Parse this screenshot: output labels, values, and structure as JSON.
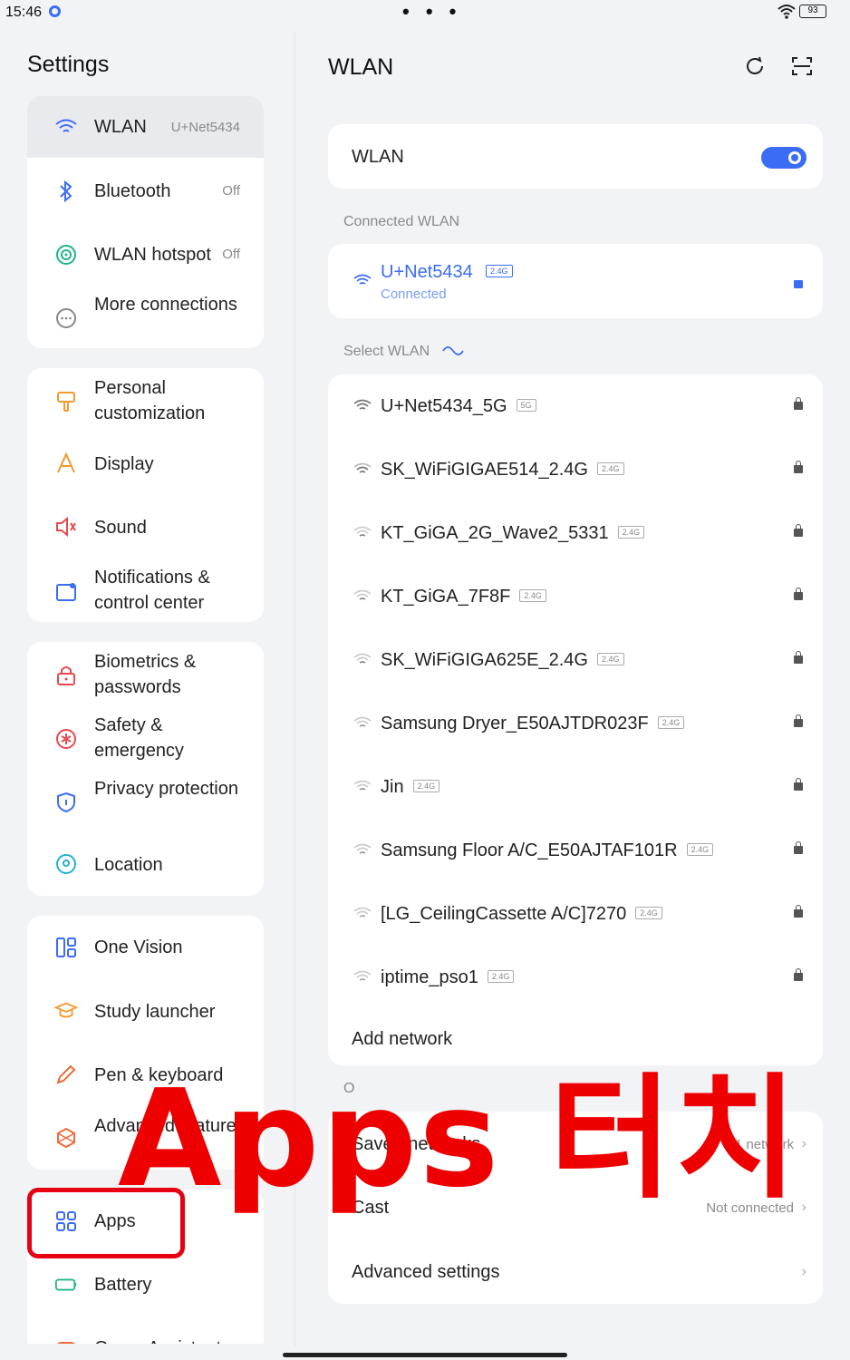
{
  "status": {
    "time": "15:46",
    "menu": "• • •",
    "battery": "93"
  },
  "sidebar": {
    "title": "Settings",
    "items": [
      {
        "label": "WLAN",
        "value": "U+Net5434",
        "icon": "wifi-icon"
      },
      {
        "label": "Bluetooth",
        "value": "Off",
        "icon": "bluetooth-icon"
      },
      {
        "label": "WLAN hotspot",
        "value": "Off",
        "icon": "hotspot-icon"
      },
      {
        "label": "More connections",
        "icon": "more-icon"
      },
      {
        "label": "Personal customization",
        "icon": "brush-icon"
      },
      {
        "label": "Display",
        "icon": "display-icon"
      },
      {
        "label": "Sound",
        "icon": "speaker-icon"
      },
      {
        "label": "Notifications & control center",
        "icon": "notification-icon"
      },
      {
        "label": "Biometrics & passwords",
        "icon": "lock-icon"
      },
      {
        "label": "Safety & emergency",
        "icon": "emergency-icon"
      },
      {
        "label": "Privacy protection",
        "icon": "shield-icon"
      },
      {
        "label": "Location",
        "icon": "location-icon"
      },
      {
        "label": "One Vision",
        "icon": "grid-layout-icon"
      },
      {
        "label": "Study launcher",
        "icon": "study-icon"
      },
      {
        "label": "Pen & keyboard",
        "icon": "pen-icon"
      },
      {
        "label": "Advanced features",
        "icon": "features-icon"
      },
      {
        "label": "Apps",
        "icon": "apps-icon"
      },
      {
        "label": "Battery",
        "icon": "battery-icon"
      },
      {
        "label": "Game Assistant",
        "icon": "game-icon"
      }
    ]
  },
  "overlay": {
    "text": "Apps 터치"
  },
  "main": {
    "title": "WLAN",
    "wlan_label": "WLAN",
    "connected_section": "Connected WLAN",
    "connected": {
      "name": "U+Net5434",
      "band": "2.4G",
      "status": "Connected"
    },
    "select_section": "Select WLAN",
    "networks": [
      {
        "name": "U+Net5434_5G",
        "band": "5G"
      },
      {
        "name": "SK_WiFiGIGAE514_2.4G",
        "band": "2.4G"
      },
      {
        "name": "KT_GiGA_2G_Wave2_5331",
        "band": "2.4G"
      },
      {
        "name": "KT_GiGA_7F8F",
        "band": "2.4G"
      },
      {
        "name": "SK_WiFiGIGA625E_2.4G",
        "band": "2.4G"
      },
      {
        "name": "Samsung Dryer_E50AJTDR023F",
        "band": "2.4G"
      },
      {
        "name": "Jin",
        "band": "2.4G"
      },
      {
        "name": "Samsung Floor A/C_E50AJTAF101R",
        "band": "2.4G"
      },
      {
        "name": "[LG_CeilingCassette A/C]7270",
        "band": "2.4G"
      },
      {
        "name": "iptime_pso1",
        "band": "2.4G"
      }
    ],
    "add_network": "Add network",
    "other_section": "O",
    "saved_networks": {
      "label": "Saved networks",
      "value": "1 network"
    },
    "cast": {
      "label": "Cast",
      "value": "Not connected"
    },
    "advanced": {
      "label": "Advanced settings"
    }
  },
  "colors": {
    "accent": "#3b6cf6",
    "overlay": "#ee0000",
    "highlight": "#e60012"
  }
}
